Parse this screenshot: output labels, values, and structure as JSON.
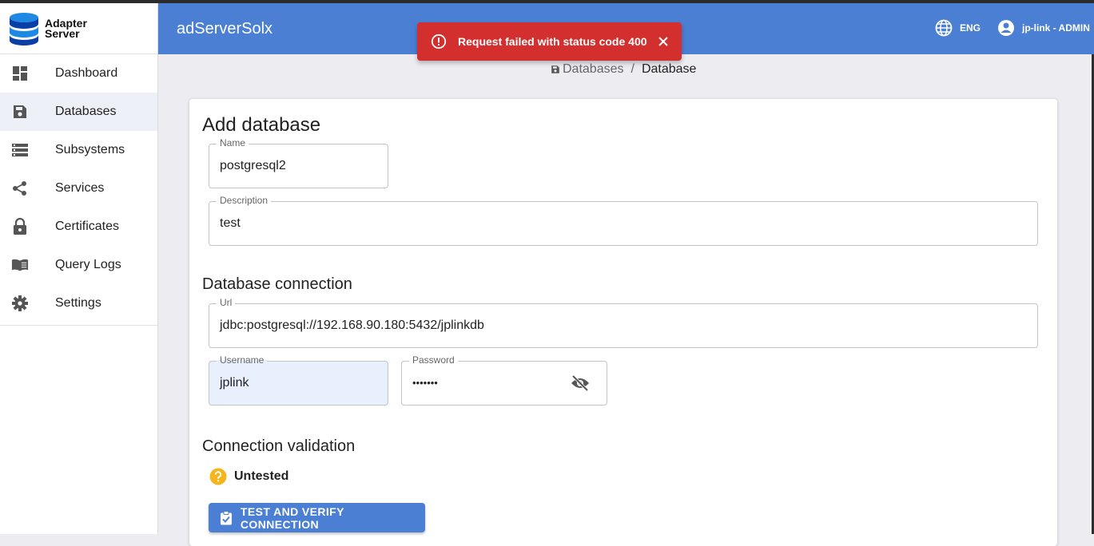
{
  "logo": {
    "line1": "Adapter",
    "line2": "Server"
  },
  "sidebar": {
    "items": [
      {
        "label": "Dashboard",
        "icon": "dashboard-icon",
        "active": false
      },
      {
        "label": "Databases",
        "icon": "database-icon",
        "active": true
      },
      {
        "label": "Subsystems",
        "icon": "subsystems-icon",
        "active": false
      },
      {
        "label": "Services",
        "icon": "share-icon",
        "active": false
      },
      {
        "label": "Certificates",
        "icon": "lock-icon",
        "active": false
      },
      {
        "label": "Query Logs",
        "icon": "book-icon",
        "active": false
      },
      {
        "label": "Settings",
        "icon": "gear-icon",
        "active": false
      }
    ]
  },
  "header": {
    "title": "adServerSolx",
    "language": "ENG",
    "user": "jp-link - ADMIN",
    "color": "#4a7fd4"
  },
  "toast": {
    "message": "Request failed with status code 400",
    "color": "#d32f2f"
  },
  "breadcrumb": {
    "parent": "Databases",
    "separator": "/",
    "current": "Database"
  },
  "form": {
    "title": "Add database",
    "name": {
      "label": "Name",
      "value": "postgresql2"
    },
    "description": {
      "label": "Description",
      "value": "test"
    },
    "connection_title": "Database connection",
    "url": {
      "label": "Url",
      "value": "jdbc:postgresql://192.168.90.180:5432/jplinkdb"
    },
    "username": {
      "label": "Username",
      "value": "jplink"
    },
    "password": {
      "label": "Password",
      "value": "•••••••"
    },
    "validation_title": "Connection validation",
    "validation_status": "Untested",
    "test_button": "TEST AND VERIFY CONNECTION"
  }
}
